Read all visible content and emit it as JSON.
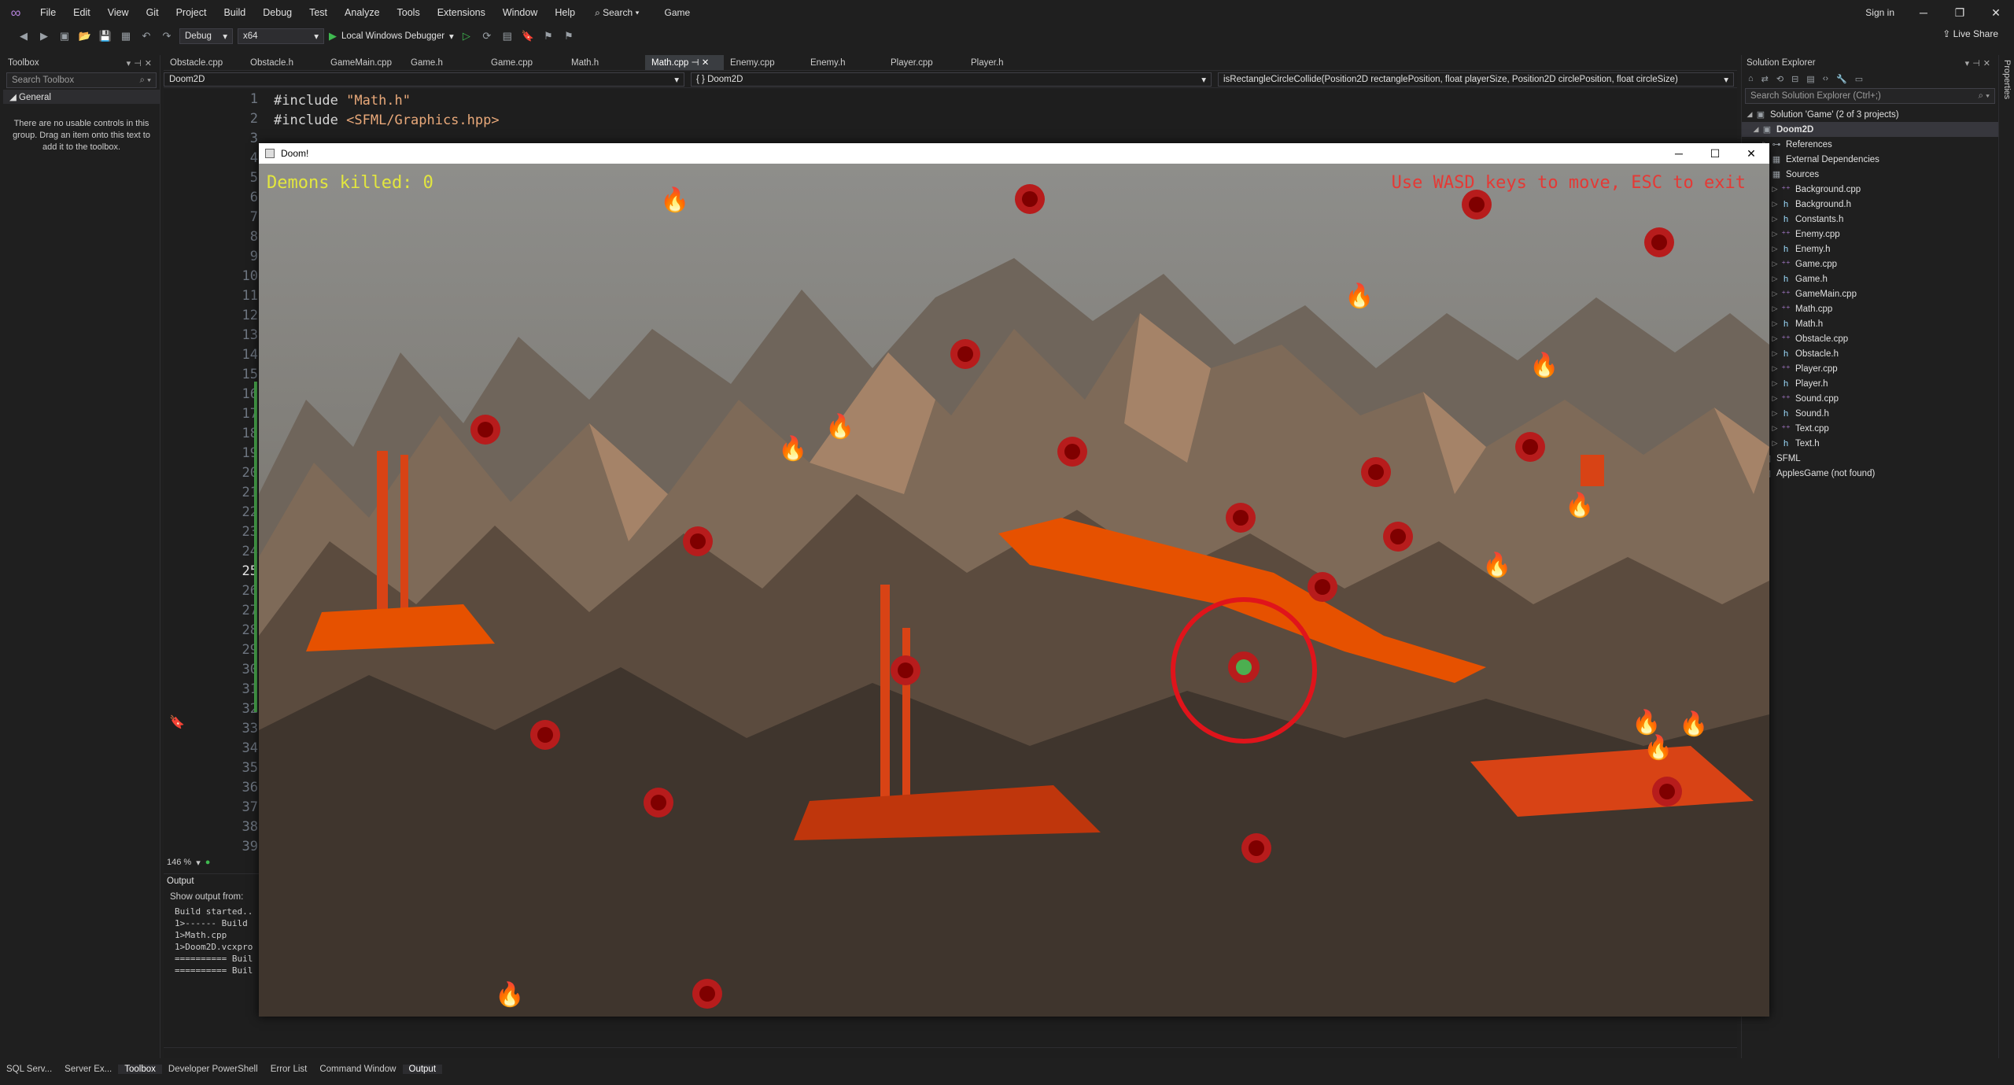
{
  "menu": {
    "items": [
      "File",
      "Edit",
      "View",
      "Git",
      "Project",
      "Build",
      "Debug",
      "Test",
      "Analyze",
      "Tools",
      "Extensions",
      "Window",
      "Help"
    ],
    "search": "Search",
    "solution_name": "Game",
    "sign_in": "Sign in",
    "live_share": "Live Share"
  },
  "toolbar": {
    "config": "Debug",
    "platform": "x64",
    "debugger": "Local Windows Debugger"
  },
  "toolbox": {
    "title": "Toolbox",
    "search_placeholder": "Search Toolbox",
    "group": "General",
    "empty_text": "There are no usable controls in this group. Drag an item onto this text to add it to the toolbox."
  },
  "editor": {
    "tabs": [
      "Obstacle.cpp",
      "Obstacle.h",
      "GameMain.cpp",
      "Game.h",
      "Game.cpp",
      "Math.h",
      "Math.cpp",
      "Enemy.cpp",
      "Enemy.h",
      "Player.cpp",
      "Player.h"
    ],
    "active_tab": "Math.cpp",
    "nav_project": "Doom2D",
    "nav_scope": "{ } Doom2D",
    "nav_function": "isRectangleCircleCollide(Position2D rectanglePosition, float playerSize, Position2D circlePosition, float circleSize)",
    "line_numbers": [
      "1",
      "2",
      "3",
      "4",
      "5",
      "6",
      "7",
      "8",
      "9",
      "10",
      "11",
      "12",
      "13",
      "14",
      "15",
      "16",
      "17",
      "18",
      "19",
      "20",
      "21",
      "22",
      "23",
      "24",
      "25",
      "26",
      "27",
      "28",
      "29",
      "30",
      "31",
      "32",
      "33",
      "34",
      "35",
      "36",
      "37",
      "38",
      "39"
    ],
    "current_line": "25",
    "code_line1_kw": "#include ",
    "code_line1_str": "\"Math.h\"",
    "code_line2_kw": "#include ",
    "code_line2_str": "<SFML/Graphics.hpp>",
    "zoom": "146 %"
  },
  "output": {
    "title": "Output",
    "show_from": "Show output from:",
    "lines": [
      "Build started..",
      "1>------ Build",
      "1>Math.cpp",
      "1>Doom2D.vcxpro",
      "========== Buil",
      "========== Buil"
    ]
  },
  "bottom_tabs": [
    "SQL Serv...",
    "Server Ex...",
    "Toolbox",
    "Developer PowerShell",
    "Error List",
    "Command Window",
    "Output"
  ],
  "bottom_active": [
    "Toolbox",
    "Output"
  ],
  "solution_explorer": {
    "title": "Solution Explorer",
    "search_placeholder": "Search Solution Explorer (Ctrl+;)",
    "solution": "Solution 'Game' (2 of 3 projects)",
    "project": "Doom2D",
    "references": "References",
    "external": "External Dependencies",
    "sources": "Sources",
    "files": [
      "Background.cpp",
      "Background.h",
      "Constants.h",
      "Enemy.cpp",
      "Enemy.h",
      "Game.cpp",
      "Game.h",
      "GameMain.cpp",
      "Math.cpp",
      "Math.h",
      "Obstacle.cpp",
      "Obstacle.h",
      "Player.cpp",
      "Player.h",
      "Sound.cpp",
      "Sound.h",
      "Text.cpp",
      "Text.h"
    ],
    "sfml": "SFML",
    "apples": "ApplesGame (not found)"
  },
  "properties_strip": "Properties",
  "game_window": {
    "title": "Doom!",
    "demons_killed": "Demons killed: 0",
    "instructions": "Use WASD keys to move, ESC to exit",
    "hud_score_color": "#e2e63f",
    "hud_text_color": "#e53935",
    "player_circle_color": "#e0141b"
  }
}
